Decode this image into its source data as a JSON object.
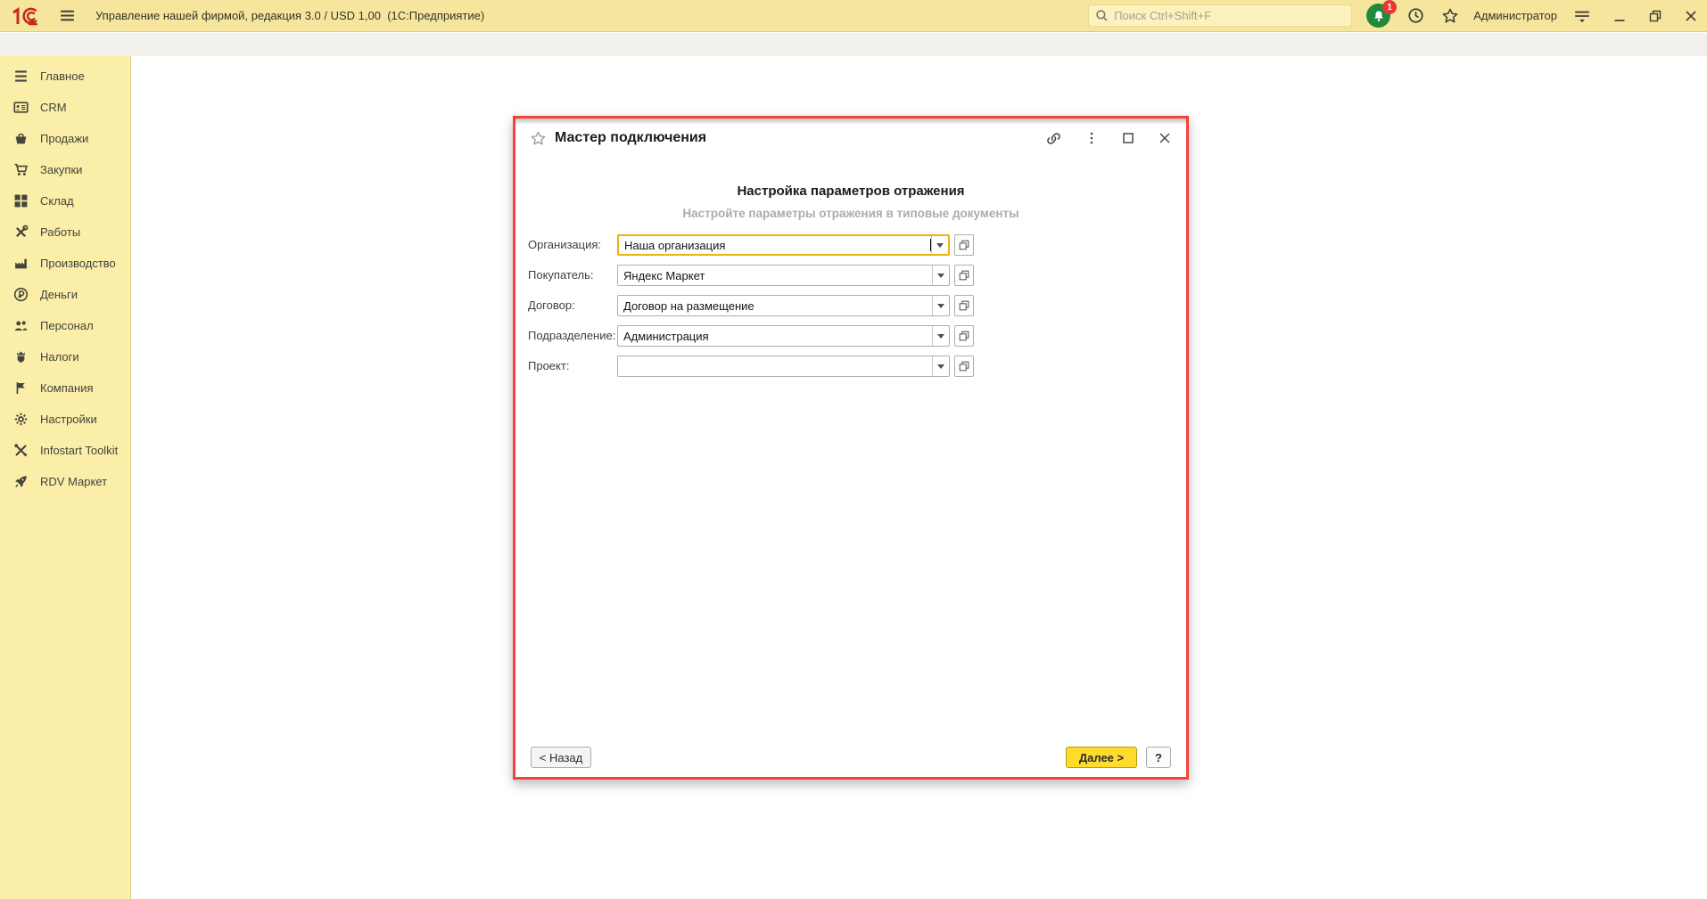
{
  "topbar": {
    "logo": "1С",
    "app_title": "Управление нашей фирмой, редакция 3.0 / USD 1,00  (1С:Предприятие)",
    "search_placeholder": "Поиск Ctrl+Shift+F",
    "notification_count": "1",
    "user_name": "Администратор"
  },
  "sidebar": {
    "items": [
      {
        "label": "Главное",
        "icon": "menu-lines"
      },
      {
        "label": "CRM",
        "icon": "contact-card"
      },
      {
        "label": "Продажи",
        "icon": "basket"
      },
      {
        "label": "Закупки",
        "icon": "cart"
      },
      {
        "label": "Склад",
        "icon": "boxes"
      },
      {
        "label": "Работы",
        "icon": "tools"
      },
      {
        "label": "Производство",
        "icon": "factory"
      },
      {
        "label": "Деньги",
        "icon": "ruble-coin"
      },
      {
        "label": "Персонал",
        "icon": "people"
      },
      {
        "label": "Налоги",
        "icon": "emblem"
      },
      {
        "label": "Компания",
        "icon": "flag"
      },
      {
        "label": "Настройки",
        "icon": "gear"
      },
      {
        "label": "Infostart Toolkit",
        "icon": "crossed-tools"
      },
      {
        "label": "RDV Маркет",
        "icon": "rocket"
      }
    ]
  },
  "dialog": {
    "title": "Мастер подключения",
    "heading": "Настройка параметров отражения",
    "subheading": "Настройте параметры отражения в типовые документы",
    "fields": [
      {
        "label": "Организация:",
        "value": "Наша организация"
      },
      {
        "label": "Покупатель:",
        "value": "Яндекс Маркет"
      },
      {
        "label": "Договор:",
        "value": "Договор на размещение"
      },
      {
        "label": "Подразделение:",
        "value": "Администрация"
      },
      {
        "label": "Проект:",
        "value": ""
      }
    ],
    "buttons": {
      "back": "< Назад",
      "next": "Далее >",
      "help": "?"
    }
  },
  "colors": {
    "highlight_red": "#F4423B",
    "focus_yellow": "#EDB30B",
    "next_button_yellow": "#FFDB2C",
    "topbar_yellow": "#F6E69D",
    "sidebar_yellow": "#FAEEA8",
    "notification_green": "#1F8A3B",
    "badge_red": "#E53935"
  }
}
